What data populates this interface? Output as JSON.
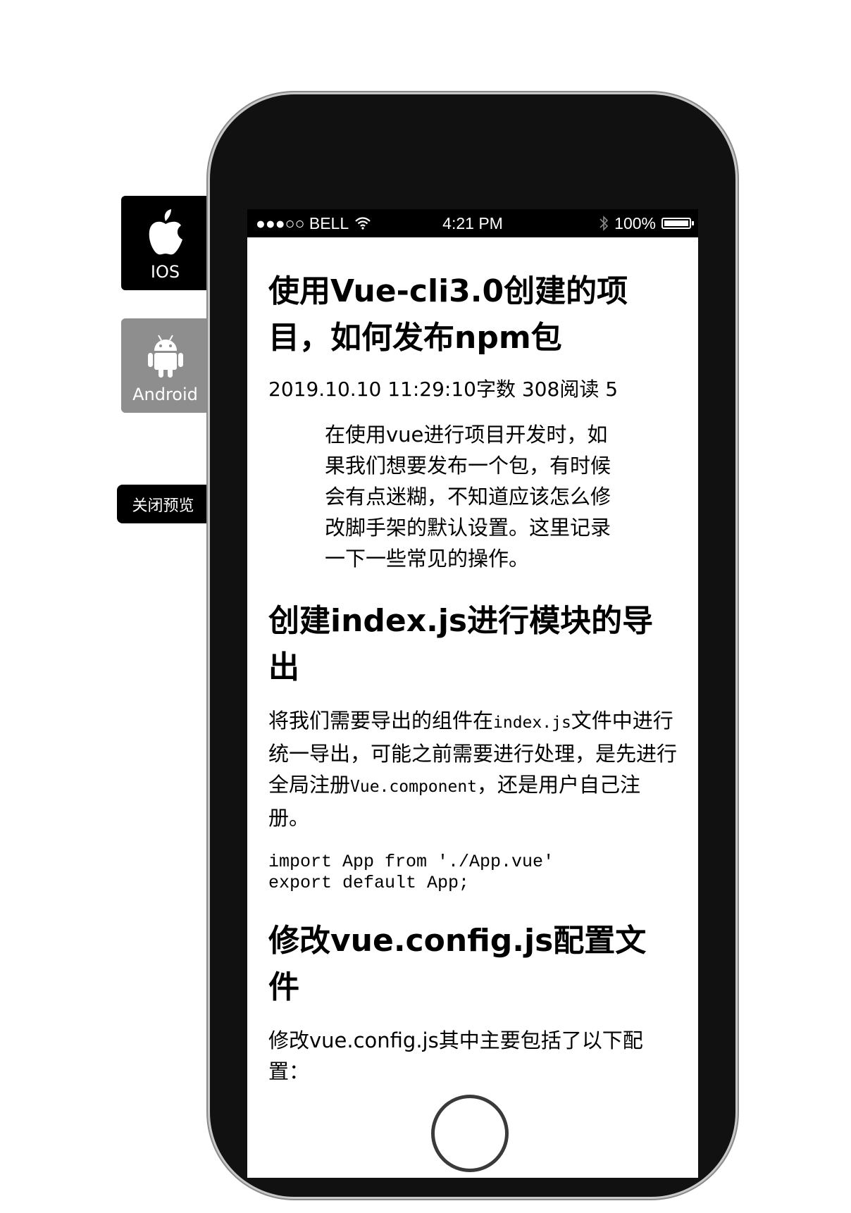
{
  "sidebar": {
    "ios_label": "IOS",
    "android_label": "Android",
    "close_label": "关闭预览"
  },
  "statusbar": {
    "carrier": "●●●○○ BELL",
    "time": "4:21 PM",
    "battery": "100%"
  },
  "article": {
    "title": "使用Vue-cli3.0创建的项目，如何发布npm包",
    "meta": "2019.10.10 11:29:10字数 308阅读 5",
    "quote": "在使用vue进行项目开发时，如果我们想要发布一个包，有时候会有点迷糊，不知道应该怎么修改脚手架的默认设置。这里记录一下一些常见的操作。",
    "section1": {
      "heading": "创建index.js进行模块的导出",
      "p_a": "将我们需要导出的组件在",
      "p_code1": "index.js",
      "p_b": "文件中进行统一导出，可能之前需要进行处理，是先进行全局注册",
      "p_code2": "Vue.component",
      "p_c": "，还是用户自己注册。",
      "code": "import App from './App.vue'\nexport default App;"
    },
    "section2": {
      "heading": "修改vue.config.js配置文件",
      "partial": "修改vue.config.js其中主要包括了以下配置："
    }
  },
  "icons": {
    "ios": "apple-icon",
    "android": "android-icon",
    "wifi": "wifi-icon",
    "bluetooth": "bluetooth-icon",
    "battery": "battery-icon"
  }
}
